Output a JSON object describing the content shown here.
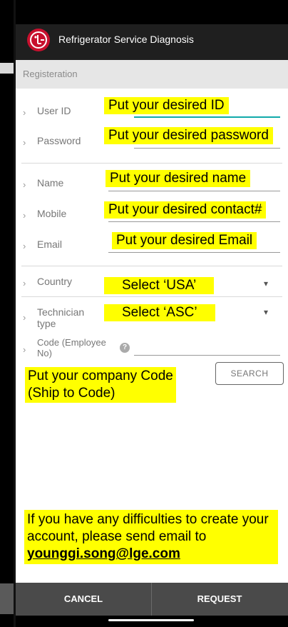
{
  "app": {
    "title": "Refrigerator Service Diagnosis"
  },
  "section": {
    "title": "Registeration"
  },
  "fields": {
    "user_id": {
      "label": "User ID",
      "annotation": "Put your desired ID"
    },
    "password": {
      "label": "Password",
      "annotation": "Put your desired password"
    },
    "name": {
      "label": "Name",
      "annotation": "Put your desired name"
    },
    "mobile": {
      "label": "Mobile",
      "annotation": "Put your desired contact#"
    },
    "email": {
      "label": "Email",
      "annotation": "Put your desired Email"
    },
    "country": {
      "label": "Country",
      "annotation": "Select ‘USA’"
    },
    "technician_type": {
      "label_line1": "Technician",
      "label_line2": "type",
      "annotation": "Select ‘ASC’"
    },
    "code": {
      "label_line1": "Code (Employee",
      "label_line2": "No)",
      "help": "?"
    }
  },
  "search_button": "SEARCH",
  "code_note": {
    "line1": "Put your company Code",
    "line2": "(Ship to Code)"
  },
  "help_note": {
    "line1": "If you have any difficulties to create your",
    "line2": "account, please send email to",
    "email": "younggi.song@lge.com"
  },
  "actions": {
    "cancel": "CANCEL",
    "request": "REQUEST"
  },
  "colors": {
    "highlight": "#ffff00",
    "brand": "#c8102e",
    "active_underline": "#11aaaa"
  }
}
